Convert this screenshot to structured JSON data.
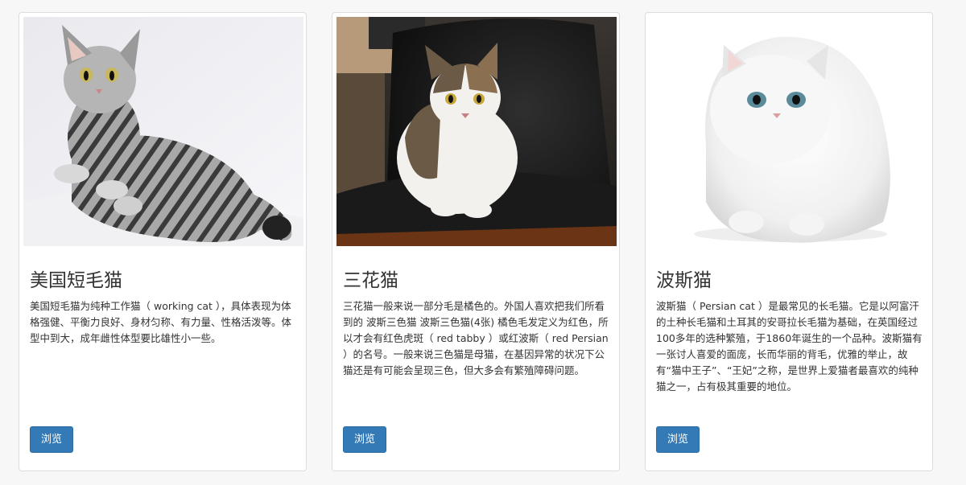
{
  "cards": [
    {
      "title": "美国短毛猫",
      "description": "美国短毛猫为纯种工作猫（ working cat ），具体表现为体格强健、平衡力良好、身材匀称、有力量、性格活泼等。体型中到大，成年雌性体型要比雄性小一些。",
      "button_label": "浏览",
      "image_subject": "silver-tabby-cat"
    },
    {
      "title": "三花猫",
      "description": "三花猫一般来说一部分毛是橘色的。外国人喜欢把我们所看到的 波斯三色猫 波斯三色猫(4张) 橘色毛发定义为红色，所以才会有红色虎斑（ red tabby ）或红波斯（ red Persian ）的名号。一般来说三色猫是母猫，在基因异常的状况下公猫还是有可能会呈现三色，但大多会有繁殖障碍问题。",
      "button_label": "浏览",
      "image_subject": "calico-cat-on-chair"
    },
    {
      "title": "波斯猫",
      "description": "波斯猫（ Persian cat ）是最常见的长毛猫。它是以阿富汗的土种长毛猫和土耳其的安哥拉长毛猫为基础，在英国经过100多年的选种繁殖，于1860年诞生的一个品种。波斯猫有一张讨人喜爱的面庞，长而华丽的背毛，优雅的举止，故有“猫中王子”、“王妃”之称，是世界上爱猫者最喜欢的纯种猫之一，占有极其重要的地位。",
      "button_label": "浏览",
      "image_subject": "white-persian-cat"
    }
  ],
  "colors": {
    "button_bg": "#337ab7",
    "card_border": "#dddddd",
    "page_bg": "#f7f7f7"
  }
}
